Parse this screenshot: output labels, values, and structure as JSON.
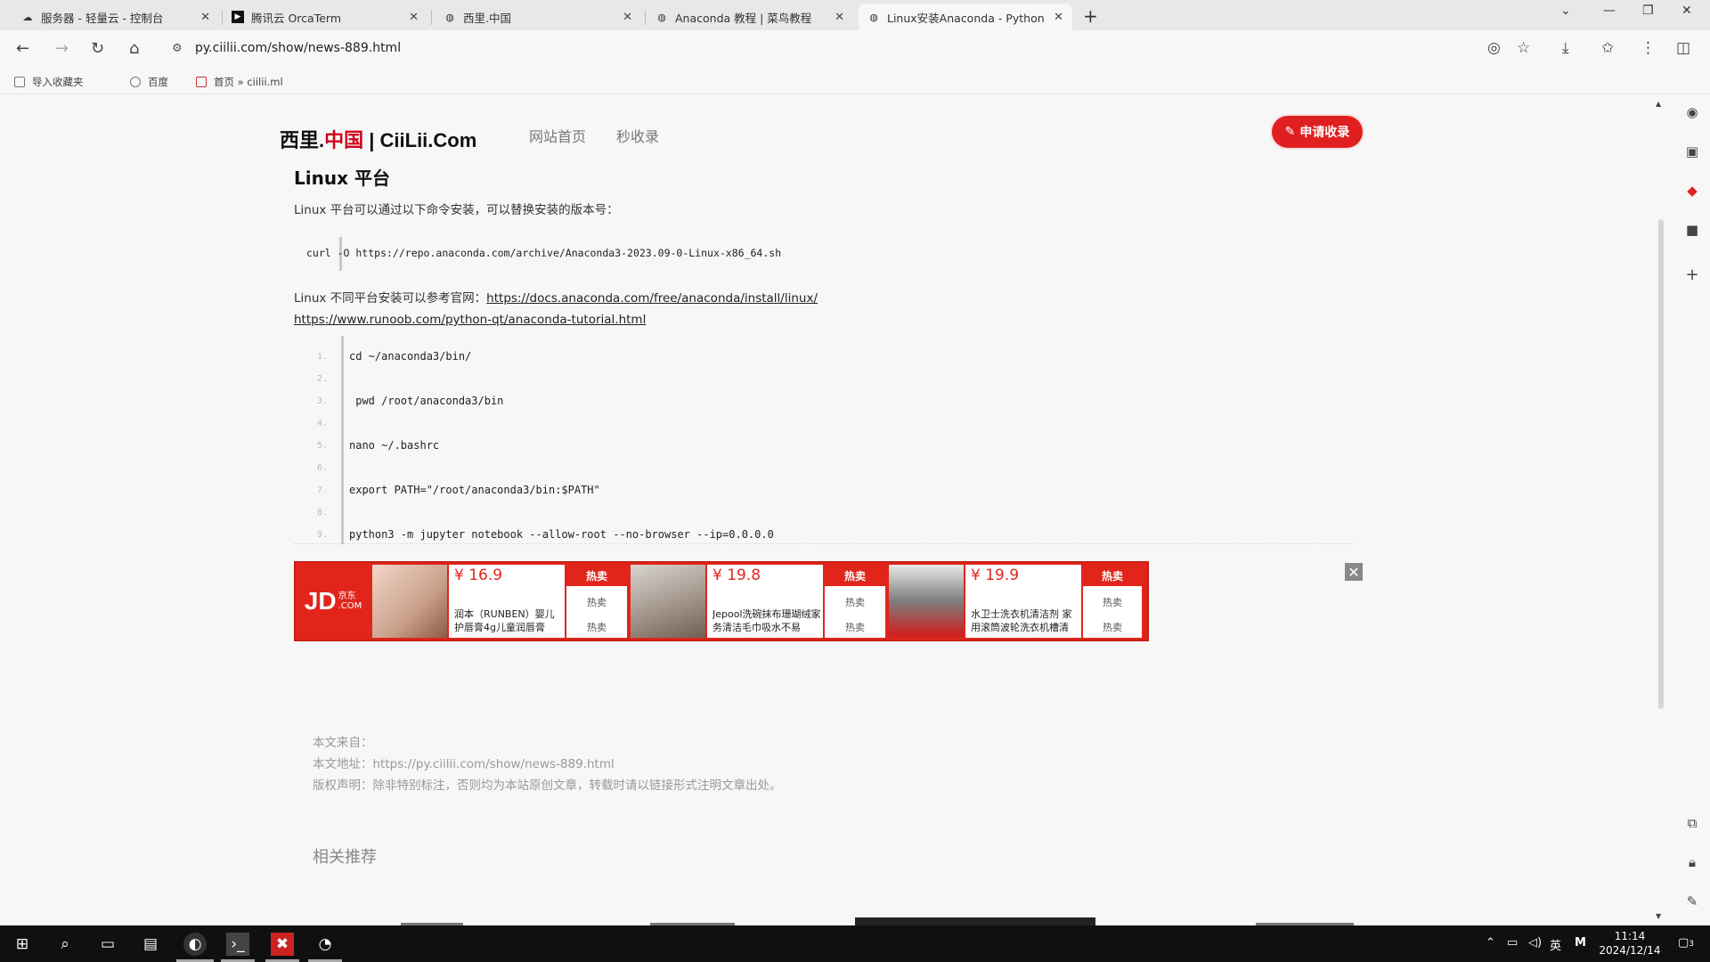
{
  "browser": {
    "tabs": [
      {
        "title": "服务器 - 轻量云 - 控制台",
        "icon": "cloud-icon"
      },
      {
        "title": "腾讯云 OrcaTerm",
        "icon": "terminal-icon"
      },
      {
        "title": "西里.中国",
        "icon": "globe-icon"
      },
      {
        "title": "Anaconda 教程 | 菜鸟教程",
        "icon": "globe-icon"
      },
      {
        "title": "Linux安装Anaconda - Python",
        "icon": "globe-icon",
        "active": true
      }
    ],
    "url": "py.ciilii.com/show/news-889.html",
    "bookmarks": [
      "导入收藏夹",
      "百度",
      "首页 » ciilii.ml"
    ]
  },
  "site": {
    "logo_part1": "西里.",
    "logo_part2": "中国",
    "logo_part3": " | CiiLii.Com",
    "nav": [
      "网站首页",
      "秒收录"
    ],
    "apply_button": "申请收录",
    "brand_color": "#d0021b"
  },
  "article": {
    "heading": "Linux 平台",
    "intro": "Linux 平台可以通过以下命令安装，可以替换安装的版本号：",
    "install_cmd": "curl -O https://repo.anaconda.com/archive/Anaconda3-2023.09-0-Linux-x86_64.sh",
    "ref_prefix": "Linux 不同平台安装可以参考官网：",
    "ref_link": "https://docs.anaconda.com/free/anaconda/install/linux/",
    "runoob_link": "https://www.runoob.com/python-qt/anaconda-tutorial.html",
    "code_lines": [
      {
        "num": "1.",
        "text": "cd ~/anaconda3/bin/"
      },
      {
        "num": "2.",
        "text": ""
      },
      {
        "num": "3.",
        "text": " pwd /root/anaconda3/bin"
      },
      {
        "num": "4.",
        "text": ""
      },
      {
        "num": "5.",
        "text": "nano ~/.bashrc"
      },
      {
        "num": "6.",
        "text": ""
      },
      {
        "num": "7.",
        "text": "export PATH=\"/root/anaconda3/bin:$PATH\""
      },
      {
        "num": "8.",
        "text": ""
      },
      {
        "num": "9.",
        "text": "python3 -m jupyter notebook --allow-root --no-browser --ip=0.0.0.0"
      }
    ]
  },
  "ad": {
    "logo": "JD",
    "logo_sub1": "京东",
    "logo_sub2": ".COM",
    "items": [
      {
        "price": "¥ 16.9",
        "desc": "润本（RUNBEN）婴儿护唇膏4g儿童润唇膏",
        "hot": "热卖"
      },
      {
        "price": "¥ 19.8",
        "desc": "Jepool洗碗抹布珊瑚绒家务清洁毛巾吸水不易",
        "hot": "热卖"
      },
      {
        "price": "¥ 19.9",
        "desc": "水卫士洗衣机清洁剂 家用滚筒波轮洗衣机槽清",
        "hot": "热卖"
      }
    ],
    "close": "✕"
  },
  "footer_meta": {
    "source": "本文来自：",
    "address_label": "本文地址：",
    "address": "https://py.ciilii.com/show/news-889.html",
    "copyright": "版权声明：除非特别标注，否则均为本站原创文章，转载时请以链接形式注明文章出处。"
  },
  "related": "相关推荐",
  "taskbar": {
    "time": "11:14",
    "date": "2024/12/14",
    "ime": "英",
    "ime2": "M",
    "notify": "3"
  }
}
